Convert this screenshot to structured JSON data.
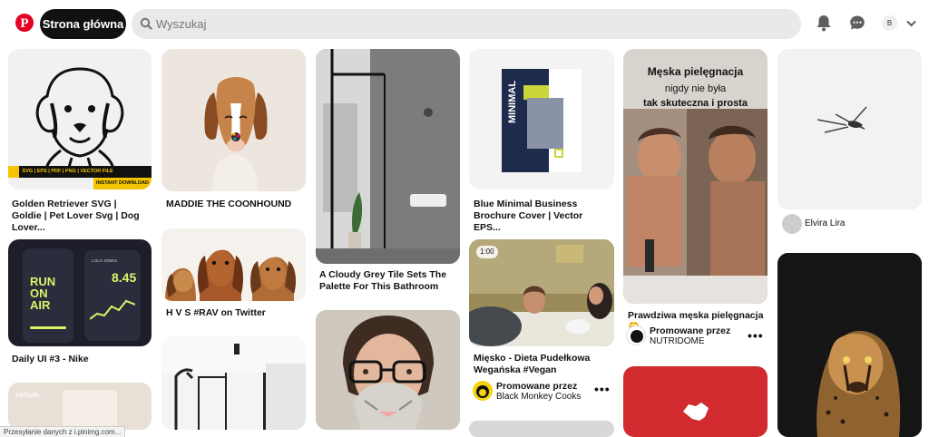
{
  "header": {
    "logo_icon": "pinterest-logo-icon",
    "home_label": "Strona główna",
    "search_placeholder": "Wyszukaj",
    "icons": [
      "bell-icon",
      "chat-bubble-icon",
      "chevron-down-icon"
    ],
    "avatar_letter": "B",
    "brand_color": "#e60023"
  },
  "pins": {
    "golden": {
      "title": "Golden Retriever SVG | Goldie | Pet Lover Svg | Dog Lover...",
      "banner_left": "SVG | EPS | PDF | PNG | VECTOR FILE",
      "banner_right": "INSTANT DOWNLOAD"
    },
    "nike": {
      "title": "Daily UI #3 - Nike",
      "screen_text": "RUN ON AIR",
      "metric": "8.45",
      "user": "LOLO JONES"
    },
    "room": {
      "watermark": "vetsak"
    },
    "coonhound": {
      "title": "MADDIE THE COONHOUND"
    },
    "dogs": {
      "title": "H V S #RAV on Twitter"
    },
    "tile": {
      "title": "A Cloudy Grey Tile Sets The Palette For This Bathroom"
    },
    "brochure": {
      "title": "Blue Minimal Business Brochure Cover | Vector EPS...",
      "cover_word": "MINIMAL"
    },
    "video": {
      "duration": "1:00",
      "title": "Mięsko - Dieta Pudełkowa Wegańska #Vegan",
      "promo_label": "Promowane przez",
      "advertiser": "Black Monkey Cooks"
    },
    "grooming": {
      "overlay_line1": "Męska pielęgnacja",
      "overlay_line2": "nigdy nie była",
      "overlay_line3": "tak skuteczna i prosta",
      "title": "Prawdziwa męska pielęgnacja 😳",
      "promo_label": "Promowane przez",
      "advertiser": "NUTRIDOME"
    },
    "bird": {
      "user": "Elvira Lira"
    }
  },
  "status": {
    "text": "Przesyłanie danych z i.pinimg.com..."
  }
}
